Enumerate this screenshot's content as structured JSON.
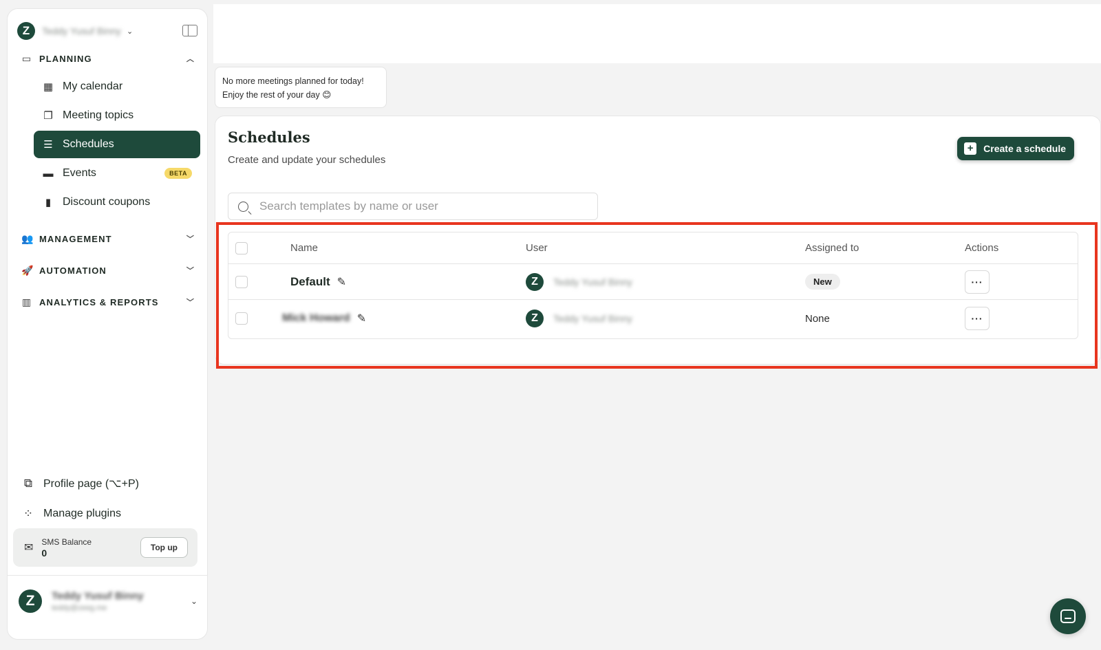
{
  "sidebar": {
    "account_name": "Teddy Yusuf Binny",
    "sections": {
      "planning": "PLANNING",
      "management": "MANAGEMENT",
      "automation": "AUTOMATION",
      "analytics": "ANALYTICS & REPORTS"
    },
    "planning_items": [
      {
        "label": "My calendar"
      },
      {
        "label": "Meeting topics"
      },
      {
        "label": "Schedules"
      },
      {
        "label": "Events",
        "badge": "BETA"
      },
      {
        "label": "Discount coupons"
      }
    ],
    "bottom_links": {
      "profile": "Profile page (⌥+P)",
      "plugins": "Manage plugins"
    },
    "sms": {
      "label": "SMS Balance",
      "value": "0",
      "topup": "Top up"
    },
    "user": {
      "name": "Teddy Yusuf Binny",
      "email": "teddy@zeeg.me"
    }
  },
  "toast": {
    "line1": "No more meetings planned for today!",
    "line2": "Enjoy the rest of your day 😊"
  },
  "main": {
    "title": "Schedules",
    "subtitle": "Create and update your schedules",
    "create_button": "Create a schedule",
    "search_placeholder": "Search templates by name or user",
    "table": {
      "headers": {
        "name": "Name",
        "user": "User",
        "assigned": "Assigned to",
        "actions": "Actions"
      },
      "rows": [
        {
          "name": "Default",
          "user": "Teddy Yusuf Binny",
          "assigned": "New",
          "actions": "···"
        },
        {
          "name": "Mick Howard",
          "user": "Teddy Yusuf Binny",
          "assigned": "None",
          "actions": "···"
        }
      ]
    }
  },
  "colors": {
    "brand": "#1e4a3b",
    "highlight": "#e8351f",
    "beta_badge": "#f6d969"
  }
}
